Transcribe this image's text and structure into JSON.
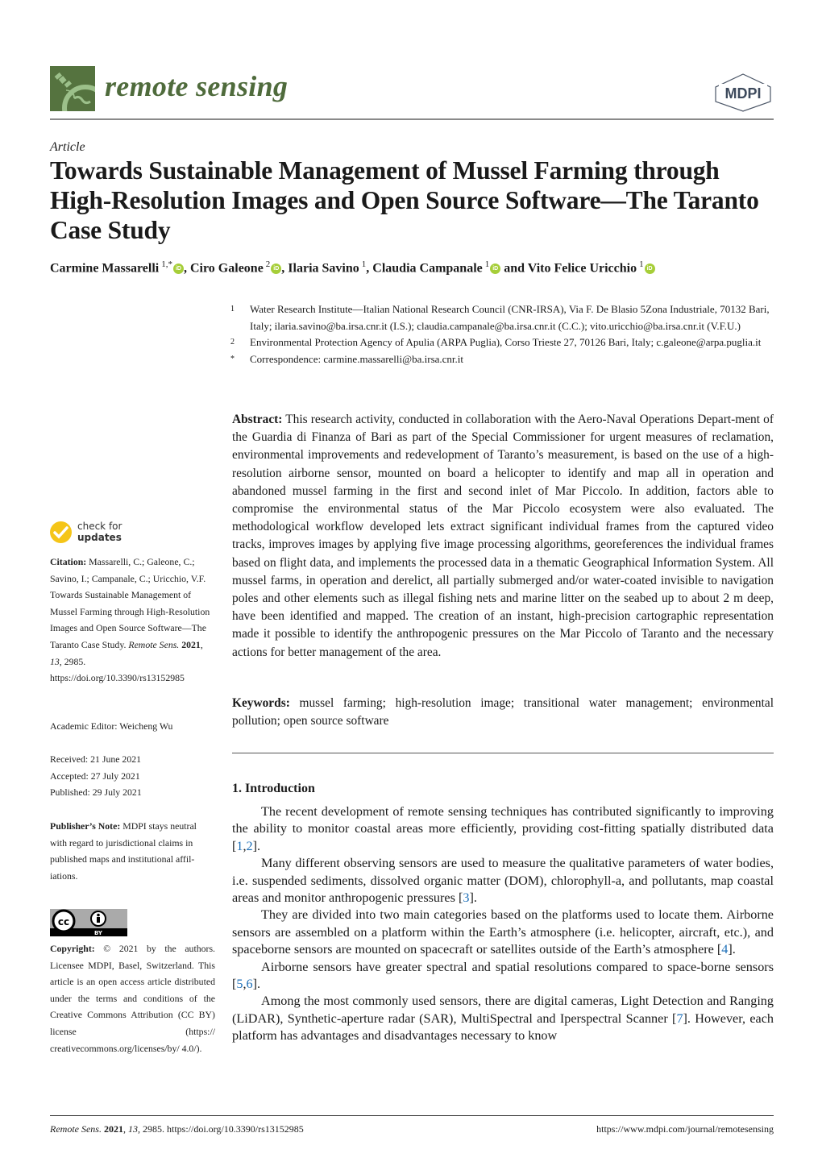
{
  "header": {
    "journal_name": "remote sensing",
    "journal_logo_icon": "satellite-globe-icon",
    "publisher": "MDPI",
    "accent_color": "#55733f"
  },
  "article": {
    "type": "Article",
    "title": "Towards Sustainable Management of Mussel Farming through High-Resolution Images and Open Source Software—The Taranto Case Study",
    "authors": [
      {
        "name": "Carmine Massarelli",
        "sup": "1,*",
        "orcid": true,
        "sep": ", "
      },
      {
        "name": "Ciro Galeone",
        "sup": "2",
        "orcid": true,
        "sep": ", "
      },
      {
        "name": "Ilaria Savino",
        "sup": "1",
        "orcid": false,
        "sep": ", "
      },
      {
        "name": "Claudia Campanale",
        "sup": "1",
        "orcid": true,
        "sep": " and "
      },
      {
        "name": "Vito Felice Uricchio",
        "sup": "1",
        "orcid": true,
        "sep": ""
      }
    ],
    "orcid_label": "iD",
    "affiliations": [
      {
        "mark": "1",
        "text": "Water Research Institute—Italian National Research Council (CNR-IRSA), Via F. De Blasio 5Zona Industriale, 70132 Bari, Italy; ilaria.savino@ba.irsa.cnr.it (I.S.); claudia.campanale@ba.irsa.cnr.it (C.C.); vito.uricchio@ba.irsa.cnr.it (V.F.U.)"
      },
      {
        "mark": "2",
        "text": "Environmental Protection Agency of Apulia (ARPA Puglia), Corso Trieste 27, 70126 Bari, Italy; c.galeone@arpa.puglia.it"
      },
      {
        "mark": "*",
        "text": "Correspondence: carmine.massarelli@ba.irsa.cnr.it"
      }
    ],
    "abstract_label": "Abstract:",
    "abstract": "This research activity, conducted in collaboration with the Aero-Naval Operations Depart-ment of the Guardia di Finanza of Bari as part of the Special Commissioner for urgent measures of reclamation, environmental improvements and redevelopment of Taranto’s measurement, is based on the use of a high-resolution airborne sensor, mounted on board a helicopter to identify and map all in operation and abandoned mussel farming in the first and second inlet of Mar Piccolo. In addition, factors able to compromise the environmental status of the Mar Piccolo ecosystem were also evaluated. The methodological workflow developed lets extract significant individual frames from the captured video tracks, improves images by applying five image processing algorithms, georeferences the individual frames based on flight data, and implements the processed data in a thematic Geographical Information System. All mussel farms, in operation and derelict, all partially submerged and/or water-coated invisible to navigation poles and other elements such as illegal fishing nets and marine litter on the seabed up to about 2 m deep, have been identified and mapped. The creation of an instant, high-precision cartographic representation made it possible to identify the anthropogenic pressures on the Mar Piccolo of Taranto and the necessary actions for better management of the area.",
    "keywords_label": "Keywords:",
    "keywords": "mussel farming; high-resolution image; transitional water management; environmental pollution; open source software"
  },
  "intro": {
    "heading": "1. Introduction",
    "paragraphs": [
      [
        {
          "t": "The recent development of remote sensing techniques has contributed significantly to improving the ability to monitor coastal areas more efficiently, providing cost-fitting spatially distributed data ["
        },
        {
          "c": "1"
        },
        {
          "t": ","
        },
        {
          "c": "2"
        },
        {
          "t": "]."
        }
      ],
      [
        {
          "t": "Many different observing sensors are used to measure the qualitative parameters of water bodies, i.e. suspended sediments, dissolved organic matter (DOM), chlorophyll-a, and pollutants, map coastal areas and monitor anthropogenic pressures ["
        },
        {
          "c": "3"
        },
        {
          "t": "]."
        }
      ],
      [
        {
          "t": "They are divided into two main categories based on the platforms used to locate them. Airborne sensors are assembled on a platform within the Earth’s atmosphere (i.e. helicopter, aircraft, etc.), and spaceborne sensors are mounted on spacecraft or satellites outside of the Earth’s atmosphere ["
        },
        {
          "c": "4"
        },
        {
          "t": "]."
        }
      ],
      [
        {
          "t": "Airborne sensors have greater spectral and spatial resolutions compared to space-borne sensors ["
        },
        {
          "c": "5"
        },
        {
          "t": ","
        },
        {
          "c": "6"
        },
        {
          "t": "]."
        }
      ],
      [
        {
          "t": "Among the most commonly used sensors, there are digital cameras, Light Detection and Ranging (LiDAR), Synthetic-aperture radar (SAR), MultiSpectral and Iperspectral Scanner ["
        },
        {
          "c": "7"
        },
        {
          "t": "]. However, each platform has advantages and disadvantages necessary to know"
        }
      ]
    ]
  },
  "sidebar": {
    "check_updates_line1": "check for",
    "check_updates_line2": "updates",
    "citation_label": "Citation:",
    "citation_text": "Massarelli, C.; Galeone, C.; Savino, I.; Campanale, C.; Uricchio, V.F. Towards Sustainable Management of Mussel Farming through High-Resolution Images and Open Source Software—The Taranto Case Study.",
    "citation_journal": "Remote Sens.",
    "citation_year": "2021",
    "citation_volume": "13",
    "citation_rest": "2985. https://doi.org/10.3390/rs13152985",
    "academic_editor": "Academic Editor: Weicheng Wu",
    "received": "Received: 21 June 2021",
    "accepted": "Accepted: 27 July 2021",
    "published": "Published: 29 July 2021",
    "publisher_note_label": "Publisher’s Note:",
    "publisher_note": "MDPI stays neutral with regard to jurisdictional claims in published maps and institutional affil-iations.",
    "cc_label": "cc",
    "cc_by": "BY",
    "copyright_label": "Copyright:",
    "copyright": "© 2021 by the authors. Licensee MDPI, Basel, Switzerland. This article is an open access article distributed under the terms and conditions of the Creative Commons Attribution (CC BY) license (https:// creativecommons.org/licenses/by/ 4.0/)."
  },
  "footer": {
    "journal_abbrev": "Remote Sens.",
    "year": "2021",
    "volume": "13",
    "rest": ", 2985. https://doi.org/10.3390/rs13152985",
    "url": "https://www.mdpi.com/journal/remotesensing"
  }
}
